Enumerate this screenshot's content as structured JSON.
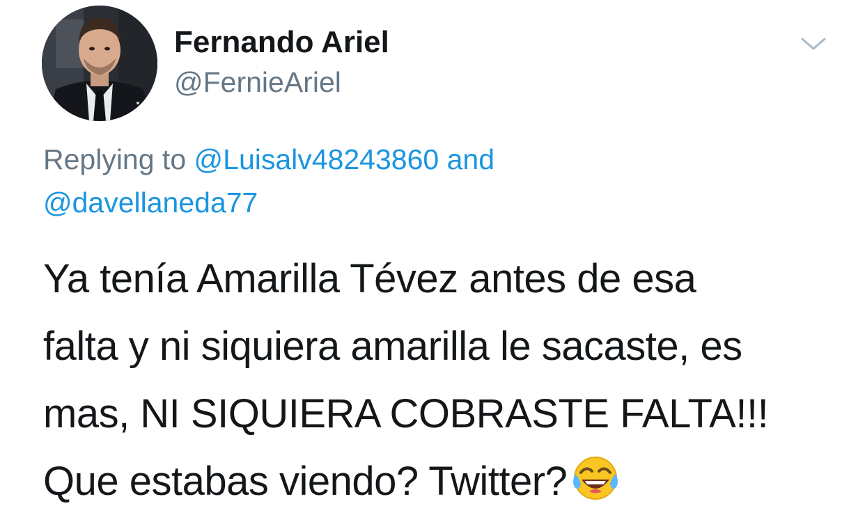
{
  "tweet": {
    "author": {
      "display_name": "Fernando Ariel",
      "handle": "@FernieAriel"
    },
    "reply": {
      "prefix": "Replying to",
      "mention_1": "@Luisalv48243860",
      "connector": "and",
      "mention_2": "@davellaneda77"
    },
    "text_lines": [
      "Ya tenía Amarilla Tévez antes de esa",
      "falta y ni siquiera amarilla le sacaste, es",
      "mas, NI SIQUIERA COBRASTE FALTA!!!",
      "Que estabas viendo? Twitter?"
    ],
    "emoji": "face-with-tears-of-joy",
    "menu_icon": "chevron-down-icon"
  },
  "colors": {
    "primary_text": "#14171a",
    "secondary_text": "#657786",
    "link": "#1b95e0",
    "chevron": "#aab8c2"
  }
}
